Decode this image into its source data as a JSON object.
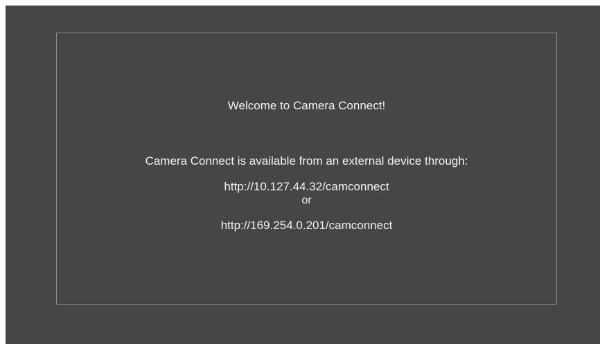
{
  "welcome_text": "Welcome to Camera Connect!",
  "availability_text": "Camera Connect is available from an external device through:",
  "urls": [
    "http://10.127.44.32/camconnect",
    "http://169.254.0.201/camconnect"
  ],
  "separator_text": "or",
  "colors": {
    "background": "#464646",
    "border": "#8c8c8c",
    "text": "#f2f2f2"
  }
}
